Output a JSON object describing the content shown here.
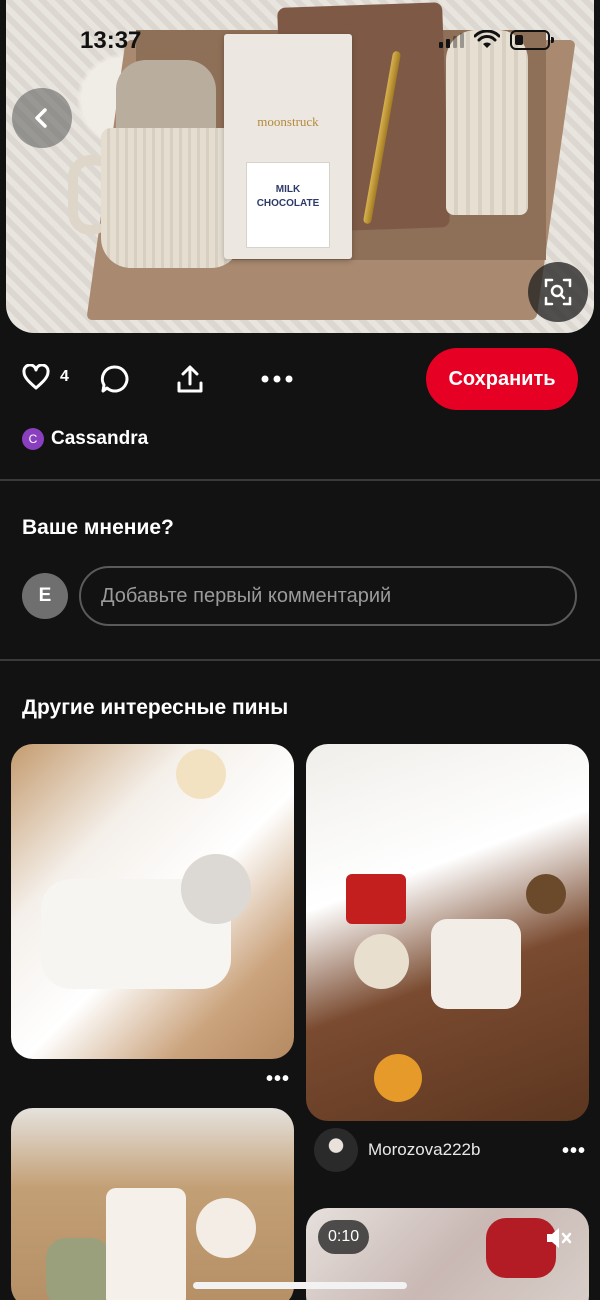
{
  "status_bar": {
    "time": "13:37"
  },
  "hero": {
    "chocolate_brand": "moonstruck",
    "chocolate_label": "MILK CHOCOLATE"
  },
  "actions": {
    "like_count": "4",
    "save_label": "Сохранить"
  },
  "author": {
    "initial": "C",
    "name": "Cassandra"
  },
  "comments": {
    "title": "Ваше мнение?",
    "avatar_initial": "E",
    "placeholder": "Добавьте первый комментарий"
  },
  "more": {
    "title": "Другие интересные пины",
    "pins": [
      {
        "more": "•••"
      },
      {
        "more": "•••",
        "user": "Morozova222b"
      },
      {},
      {
        "video_time": "0:10"
      }
    ]
  },
  "colors": {
    "accent": "#e60023",
    "background": "#121212"
  }
}
